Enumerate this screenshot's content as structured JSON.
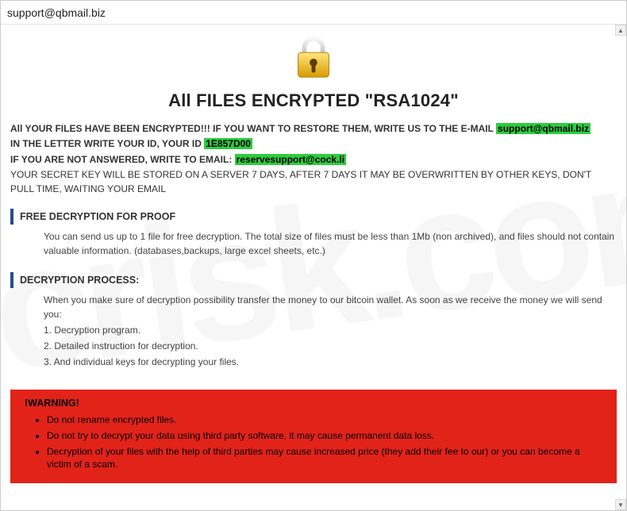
{
  "titlebar": {
    "title": "support@qbmail.biz"
  },
  "heading": "All FILES ENCRYPTED \"RSA1024\"",
  "main": {
    "line1_pre": "All YOUR FILES HAVE BEEN ENCRYPTED!!! IF YOU WANT TO RESTORE THEM, WRITE US TO THE E-MAIL ",
    "email1": "support@qbmail.biz",
    "line2_pre": "IN THE LETTER WRITE YOUR ID, YOUR ID ",
    "id_value": "1E857D00",
    "line3_pre": "IF YOU ARE NOT ANSWERED, WRITE TO EMAIL: ",
    "email2": "reservesupport@cock.li",
    "line4": "YOUR SECRET KEY WILL BE STORED ON A SERVER 7 DAYS, AFTER 7 DAYS IT MAY BE OVERWRITTEN BY OTHER KEYS, DON'T PULL TIME, WAITING YOUR EMAIL"
  },
  "proof": {
    "title": "FREE DECRYPTION FOR PROOF",
    "body": "You can send us up to 1 file for free decryption. The total size of files must be less than 1Mb (non archived), and files should not contain valuable information. (databases,backups, large excel sheets, etc.)"
  },
  "process": {
    "title": "DECRYPTION PROCESS:",
    "intro": "When you make sure of decryption possibility transfer the money to our bitcoin wallet. As soon as we receive the money we will send you:",
    "steps": [
      "1. Decryption program.",
      "2. Detailed instruction for decryption.",
      "3. And individual keys for decrypting your files."
    ]
  },
  "warning": {
    "title": "!WARNING!",
    "items": [
      "Do not rename encrypted files.",
      "Do not try to decrypt your data using third party software, it may cause permanent data loss.",
      "Decryption of your files with the help of third parties may cause increased price (they add their fee to our) or you can become a victim of a scam."
    ]
  },
  "watermark": "pcrisk.com"
}
